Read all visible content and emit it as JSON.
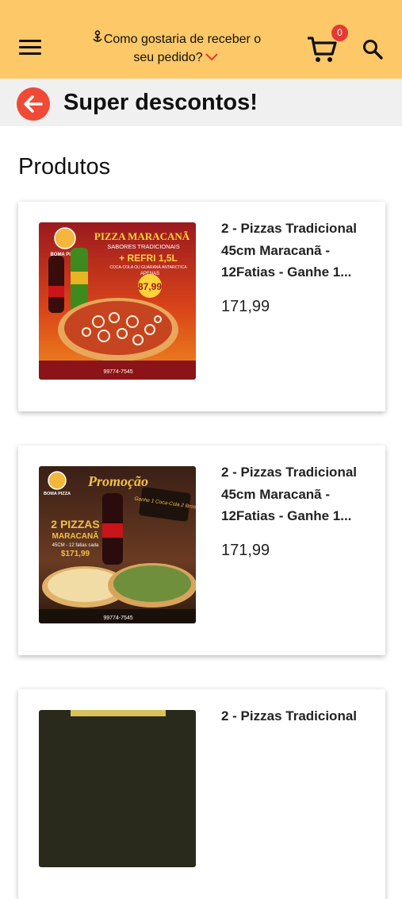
{
  "header": {
    "delivery_prompt": "Como gostaria de receber o seu pedido?",
    "cart_count": "0",
    "accent": "#e53935",
    "background": "#fcc868"
  },
  "subheader": {
    "title": "Super descontos!",
    "back_color": "#f04a36"
  },
  "section": {
    "title": "Produtos"
  },
  "products": [
    {
      "name": "2 - Pizzas Tradicional 45cm Maracanã - 12Fatias - Ganhe 1...",
      "price": "171,99",
      "image_text": {
        "brand": "BOMA PIZZA",
        "headline": "PIZZA MARACANÃ",
        "subline": "SABORES TRADICIONAIS",
        "combo": "+ REFRI 1,5L",
        "drink": "COCA-COLA OU GUARANÁ ANTARCTICA",
        "apenas": "APENAS",
        "price": "87,99",
        "phone": "99774-7545"
      }
    },
    {
      "name": "2 - Pizzas Tradicional 45cm Maracanã - 12Fatias - Ganhe 1...",
      "price": "171,99",
      "image_text": {
        "brand": "BOMA PIZZA",
        "headline": "Promoção",
        "badge": "Ganhe 1 Coca-Cola 2 litros!",
        "line1": "2 PIZZAS",
        "line2": "MARACANÃ",
        "detail": "45CM - 12 fatias cada",
        "price": "$171,99",
        "phone": "99774-7545"
      }
    },
    {
      "name": "2 - Pizzas Tradicional",
      "price": ""
    }
  ]
}
